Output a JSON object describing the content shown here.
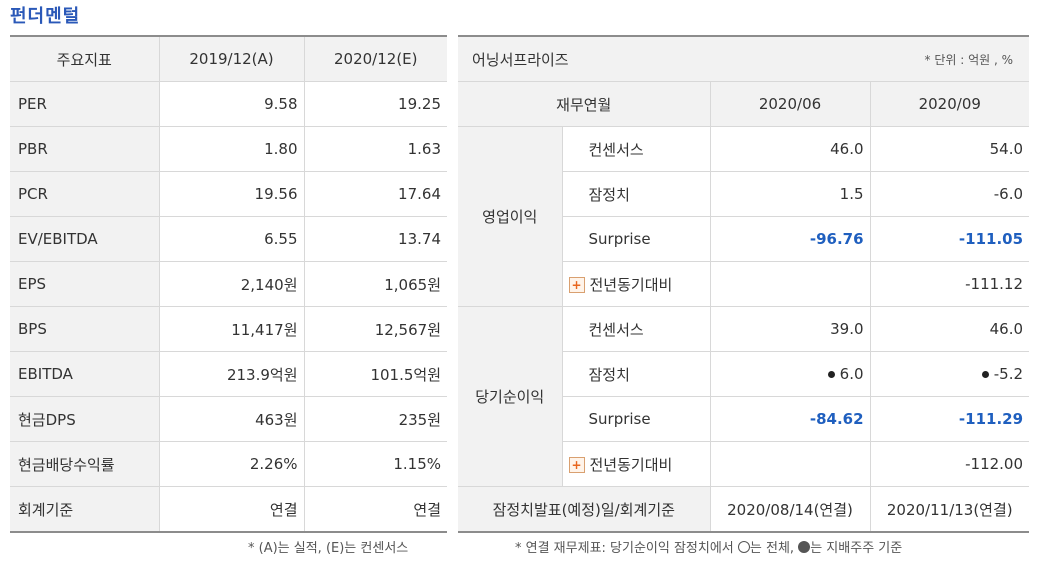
{
  "title": "펀더멘털",
  "left_table": {
    "headers": [
      "주요지표",
      "2019/12(A)",
      "2020/12(E)"
    ],
    "rows": [
      {
        "label": "PER",
        "a": "9.58",
        "e": "19.25"
      },
      {
        "label": "PBR",
        "a": "1.80",
        "e": "1.63"
      },
      {
        "label": "PCR",
        "a": "19.56",
        "e": "17.64"
      },
      {
        "label": "EV/EBITDA",
        "a": "6.55",
        "e": "13.74"
      },
      {
        "label": "EPS",
        "a": "2,140원",
        "e": "1,065원"
      },
      {
        "label": "BPS",
        "a": "11,417원",
        "e": "12,567원"
      },
      {
        "label": "EBITDA",
        "a": "213.9억원",
        "e": "101.5억원"
      },
      {
        "label": "현금DPS",
        "a": "463원",
        "e": "235원"
      },
      {
        "label": "현금배당수익률",
        "a": "2.26%",
        "e": "1.15%"
      },
      {
        "label": "회계기준",
        "a": "연결",
        "e": "연결"
      }
    ],
    "note": "* (A)는 실적, (E)는 컨센서스"
  },
  "right_table": {
    "caption": "어닝서프라이즈",
    "unit": "* 단위 : 억원 , %",
    "col_header": "재무연월",
    "periods": [
      "2020/06",
      "2020/09"
    ],
    "op_income": {
      "group": "영업이익",
      "consensus": {
        "label": "컨센서스",
        "v1": "46.0",
        "v2": "54.0"
      },
      "provisional": {
        "label": "잠정치",
        "v1": "1.5",
        "v2": "-6.0"
      },
      "surprise": {
        "label": "Surprise",
        "v1": "-96.76",
        "v2": "-111.05"
      },
      "yoy": {
        "label": "전년동기대비",
        "v1": "",
        "v2": "-111.12"
      }
    },
    "net_income": {
      "group": "당기순이익",
      "consensus": {
        "label": "컨센서스",
        "v1": "39.0",
        "v2": "46.0"
      },
      "provisional": {
        "label": "잠정치",
        "v1": "6.0",
        "v2": "-5.2"
      },
      "surprise": {
        "label": "Surprise",
        "v1": "-84.62",
        "v2": "-111.29"
      },
      "yoy": {
        "label": "전년동기대비",
        "v1": "",
        "v2": "-112.00"
      }
    },
    "footer": {
      "label": "잠정치발표(예정)일/회계기준",
      "v1": "2020/08/14(연결)",
      "v2": "2020/11/13(연결)"
    },
    "note_prefix": "* 연결 재무제표: 당기순이익 잠정치에서",
    "note_mid": "는 전체,",
    "note_suffix": "는 지배주주 기준"
  },
  "colors": {
    "title": "#2a58b8",
    "surprise": "#1f5fbf",
    "expand": "#e8661e"
  }
}
